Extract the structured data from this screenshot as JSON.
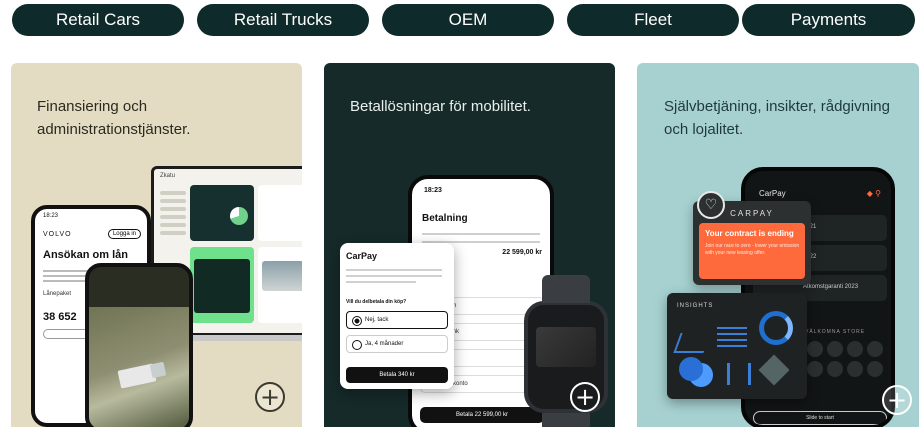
{
  "tabs": [
    {
      "label": "Retail Cars"
    },
    {
      "label": "Retail Trucks"
    },
    {
      "label": "OEM"
    },
    {
      "label": "Fleet"
    },
    {
      "label": "Payments"
    }
  ],
  "cards": [
    {
      "title": "Finansiering och\nadministrationstjänster.",
      "bg_color": "#e4dcc2",
      "action_icon": "plus-circle-icon",
      "action_glyph": "+",
      "phone": {
        "time": "18:23",
        "brand": "VOLVO",
        "login": "Logga in",
        "heading": "Ansökan om lån",
        "label": "Lånepaket",
        "amount": "38 652"
      },
      "laptop": {
        "header": "Zkatu"
      }
    },
    {
      "title": "Betallösningar för mobilitet.",
      "bg_color": "#162a2a",
      "action_icon": "plus-circle-icon",
      "action_glyph": "+",
      "phone": {
        "time": "18:23",
        "title": "Betalning",
        "total": "22 599,00 kr",
        "options": [
          "med Swish",
          "via din bank",
          "med Kort",
          "med Zikk konto"
        ],
        "pay_button": "Betala 22 599,00 kr"
      },
      "modal": {
        "logo": "CarPay",
        "question": "Vill du delbetala din köp?",
        "options": [
          "Nej, tack",
          "Ja, 4 månader"
        ],
        "button": "Betala 340 kr"
      }
    },
    {
      "title": "Självbetjäning, insikter, rådgivning\noch lojalitet.",
      "bg_color": "#a7d1d1",
      "action_icon": "plus-circle-icon",
      "action_glyph": "+",
      "phone": {
        "logo": "CarPay",
        "rows": [
          "2021",
          "2022",
          "Åtkomstgaranti 2023"
        ],
        "heading": "VÄLKOMNA STORE",
        "slide": "Slide to start"
      },
      "contract": {
        "brand": "CARPAY",
        "title": "Your contract is ending",
        "text": "Join our race to zero - lower your emission with your new leasing offer."
      },
      "insights": {
        "title": "INSIGHTS"
      },
      "heart_icon": "heart-icon"
    }
  ],
  "colors": {
    "tab_bg": "#0f2a2a",
    "accent_orange": "#ff6a3d",
    "accent_blue": "#3b7fd9",
    "accent_green": "#6fe08c"
  }
}
